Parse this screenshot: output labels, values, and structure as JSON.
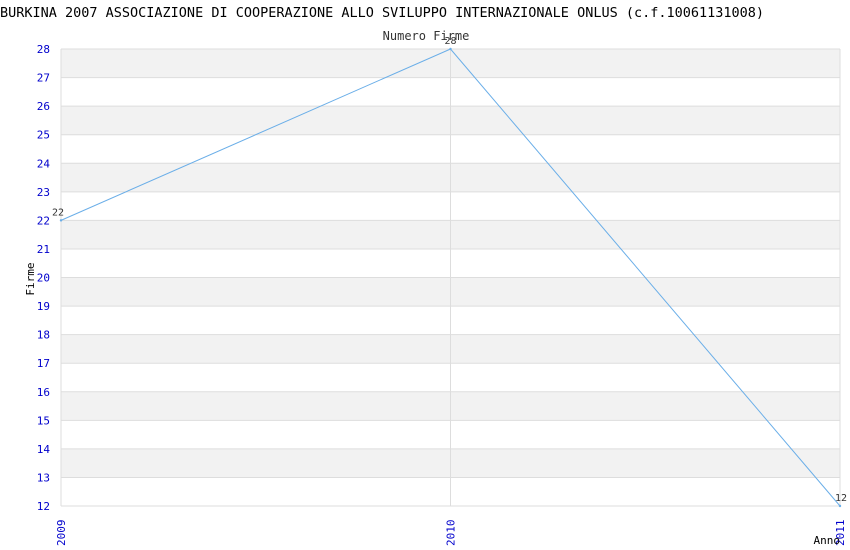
{
  "title": "BURKINA 2007 ASSOCIAZIONE DI COOPERAZIONE ALLO SVILUPPO INTERNAZIONALE ONLUS (c.f.10061131008)",
  "chart_data": {
    "type": "line",
    "title": "BURKINA 2007 ASSOCIAZIONE DI COOPERAZIONE ALLO SVILUPPO INTERNAZIONALE ONLUS (c.f.10061131008)",
    "xlabel": "Anno",
    "ylabel": "Firme",
    "x": [
      "2009",
      "2010",
      "2011"
    ],
    "series": [
      {
        "name": "Numero Firme",
        "values": [
          22,
          28,
          12
        ]
      }
    ],
    "ylim": [
      12,
      28
    ],
    "yticks": [
      12,
      13,
      14,
      15,
      16,
      17,
      18,
      19,
      20,
      21,
      22,
      23,
      24,
      25,
      26,
      27,
      28
    ],
    "grid": true,
    "legend": "top-center",
    "colors": {
      "line": "#6aaee8",
      "band": "#f2f2f2",
      "grid": "#dddddd",
      "tick_text": "#0000cc"
    }
  }
}
